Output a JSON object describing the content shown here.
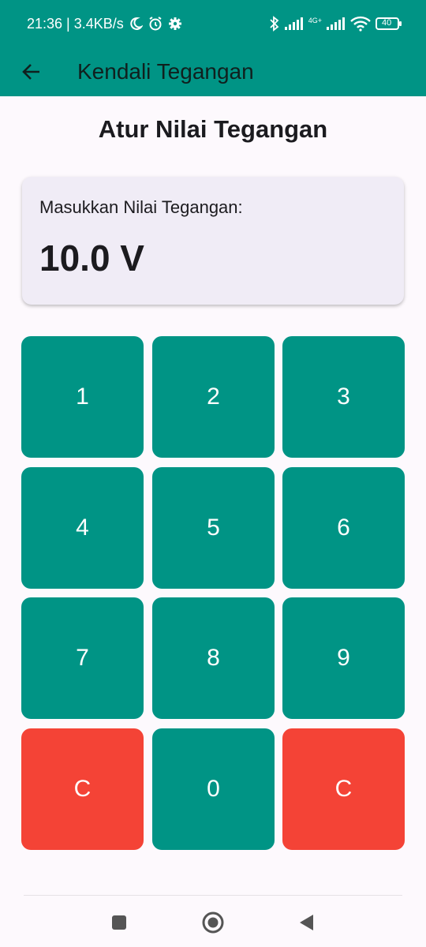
{
  "status_bar": {
    "time_speed": "21:36 | 3.4KB/s",
    "network_label": "4G+",
    "battery": "40",
    "icons": [
      "moon-icon",
      "alarm-icon",
      "gear-icon",
      "bluetooth-icon",
      "signal-icon",
      "wifi-icon",
      "battery-icon"
    ]
  },
  "app_bar": {
    "title": "Kendali Tegangan",
    "back_icon": "arrow-left-icon"
  },
  "main": {
    "title": "Atur Nilai Tegangan",
    "display": {
      "label": "Masukkan Nilai Tegangan:",
      "value": "10.0 V"
    },
    "keypad": {
      "keys": [
        {
          "label": "1",
          "type": "digit"
        },
        {
          "label": "2",
          "type": "digit"
        },
        {
          "label": "3",
          "type": "digit"
        },
        {
          "label": "4",
          "type": "digit"
        },
        {
          "label": "5",
          "type": "digit"
        },
        {
          "label": "6",
          "type": "digit"
        },
        {
          "label": "7",
          "type": "digit"
        },
        {
          "label": "8",
          "type": "digit"
        },
        {
          "label": "9",
          "type": "digit"
        },
        {
          "label": "C",
          "type": "clear"
        },
        {
          "label": "0",
          "type": "digit"
        },
        {
          "label": "C",
          "type": "clear"
        }
      ]
    }
  },
  "colors": {
    "primary": "#009485",
    "clear": "#f44336",
    "card": "#f0ecf6",
    "background": "#fdf9fd"
  },
  "nav_bar": {
    "icons": [
      "recents-square-icon",
      "home-circle-icon",
      "back-triangle-icon"
    ]
  }
}
